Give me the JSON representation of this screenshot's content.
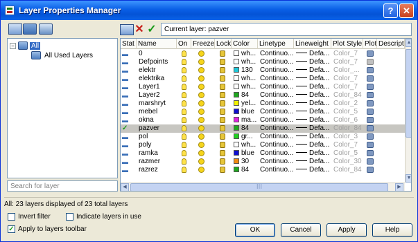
{
  "window": {
    "title": "Layer Properties Manager",
    "help_label": "?",
    "close_label": "✕"
  },
  "toolbar": {
    "current_layer_text": "Current layer: pazver",
    "delete_icon": "✕",
    "set_current_icon": "✓"
  },
  "tree": {
    "expander": "−",
    "root_label": "All",
    "child_label": "All Used Layers"
  },
  "search": {
    "placeholder": "Search for layer"
  },
  "columns": [
    "Stat",
    "Name",
    "On",
    "Freeze",
    "Lock",
    "Color",
    "Linetype",
    "Lineweight",
    "Plot Style",
    "Plot",
    "Descriptio"
  ],
  "layers": [
    {
      "name": "0",
      "color_hex": "#ffffff",
      "color_name": "wh...",
      "linetype": "Continuo...",
      "lineweight": "Defa...",
      "plot_style": "Color_7",
      "plot": "on",
      "current": false
    },
    {
      "name": "Defpoints",
      "color_hex": "#ffffff",
      "color_name": "wh...",
      "linetype": "Continuo...",
      "lineweight": "Defa...",
      "plot_style": "Color_7",
      "plot": "off",
      "current": false
    },
    {
      "name": "elektr",
      "color_hex": "#1ec8d8",
      "color_name": "130",
      "linetype": "Continuo...",
      "lineweight": "Defa...",
      "plot_style": "Color_...",
      "plot": "on",
      "current": false
    },
    {
      "name": "elektrika",
      "color_hex": "#ffffff",
      "color_name": "wh...",
      "linetype": "Continuo...",
      "lineweight": "Defa...",
      "plot_style": "Color_7",
      "plot": "on",
      "current": false
    },
    {
      "name": "Layer1",
      "color_hex": "#ffffff",
      "color_name": "wh...",
      "linetype": "Continuo...",
      "lineweight": "Defa...",
      "plot_style": "Color_7",
      "plot": "on",
      "current": false
    },
    {
      "name": "Layer2",
      "color_hex": "#1ea81e",
      "color_name": "84",
      "linetype": "Continuo...",
      "lineweight": "Defa...",
      "plot_style": "Color_84",
      "plot": "on",
      "current": false
    },
    {
      "name": "marshryt",
      "color_hex": "#f0f000",
      "color_name": "yel...",
      "linetype": "Continuo...",
      "lineweight": "Defa...",
      "plot_style": "Color_2",
      "plot": "on",
      "current": false
    },
    {
      "name": "mebel",
      "color_hex": "#1010d0",
      "color_name": "blue",
      "linetype": "Continuo...",
      "lineweight": "Defa...",
      "plot_style": "Color_5",
      "plot": "on",
      "current": false
    },
    {
      "name": "okna",
      "color_hex": "#e020e0",
      "color_name": "ma...",
      "linetype": "Continuo...",
      "lineweight": "Defa...",
      "plot_style": "Color_6",
      "plot": "on",
      "current": false
    },
    {
      "name": "pazver",
      "color_hex": "#1ea81e",
      "color_name": "84",
      "linetype": "Continuo...",
      "lineweight": "Defa...",
      "plot_style": "Color_84",
      "plot": "on",
      "current": true
    },
    {
      "name": "pol",
      "color_hex": "#20d020",
      "color_name": "gr...",
      "linetype": "Continuo...",
      "lineweight": "Defa...",
      "plot_style": "Color_3",
      "plot": "on",
      "current": false
    },
    {
      "name": "poly",
      "color_hex": "#ffffff",
      "color_name": "wh...",
      "linetype": "Continuo...",
      "lineweight": "Defa...",
      "plot_style": "Color_7",
      "plot": "on",
      "current": false
    },
    {
      "name": "ramka",
      "color_hex": "#1010d0",
      "color_name": "blue",
      "linetype": "Continuo...",
      "lineweight": "Defa...",
      "plot_style": "Color_5",
      "plot": "on",
      "current": false
    },
    {
      "name": "razmer",
      "color_hex": "#f08a10",
      "color_name": "30",
      "linetype": "Continuo...",
      "lineweight": "Defa...",
      "plot_style": "Color_30",
      "plot": "on",
      "current": false
    },
    {
      "name": "razrez",
      "color_hex": "#1ea81e",
      "color_name": "84",
      "linetype": "Continuo...",
      "lineweight": "Defa...",
      "plot_style": "Color_84",
      "plot": "on",
      "current": false
    }
  ],
  "scroll": {
    "up": "▲",
    "down": "▼",
    "left": "◀",
    "right": "▶",
    "grip": "III"
  },
  "status_text": "All: 23 layers displayed of 23 total layers",
  "options": {
    "invert_filter_label": "Invert filter",
    "invert_filter_checked": false,
    "indicate_layers_label": "Indicate layers in use",
    "indicate_layers_checked": false,
    "apply_toolbar_label": "Apply to layers toolbar",
    "apply_toolbar_checked": true,
    "check_mark": "✓"
  },
  "buttons": {
    "ok": "OK",
    "cancel": "Cancel",
    "apply": "Apply",
    "help": "Help"
  }
}
